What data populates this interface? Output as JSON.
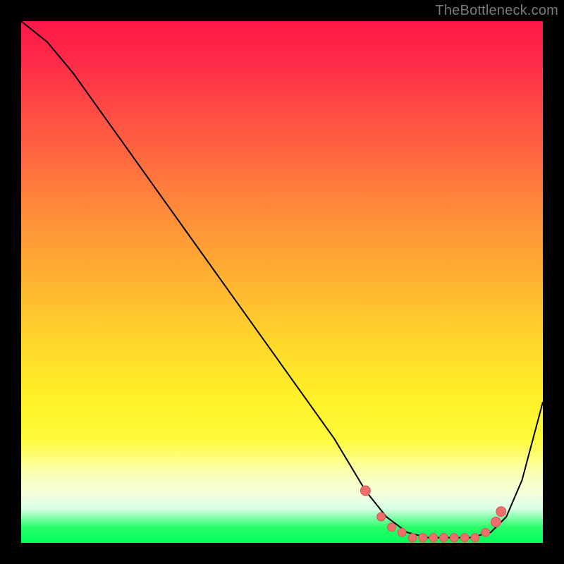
{
  "attribution": "TheBottleneck.com",
  "colors": {
    "curve": "#000000",
    "dot_fill": "#ee6e6c",
    "dot_stroke": "#d05a58"
  },
  "chart_data": {
    "type": "line",
    "title": "",
    "xlabel": "",
    "ylabel": "",
    "xlim": [
      0,
      100
    ],
    "ylim": [
      0,
      100
    ],
    "series": [
      {
        "name": "bottleneck-curve",
        "x": [
          0,
          5,
          10,
          15,
          20,
          25,
          30,
          35,
          40,
          45,
          50,
          55,
          60,
          63,
          66,
          70,
          74,
          78,
          82,
          86,
          90,
          93,
          96,
          100
        ],
        "y": [
          100,
          96,
          90,
          83,
          76,
          69,
          62,
          55,
          48,
          41,
          34,
          27,
          20,
          15,
          10,
          5,
          2,
          1,
          1,
          1,
          2,
          5,
          12,
          27
        ]
      }
    ],
    "dots": {
      "name": "optimal-zone",
      "x": [
        66,
        69,
        71,
        73,
        75,
        77,
        79,
        81,
        83,
        85,
        87,
        89,
        91,
        92
      ],
      "y": [
        10,
        5,
        3,
        2,
        1,
        1,
        1,
        1,
        1,
        1,
        1,
        2,
        4,
        6
      ]
    },
    "gradient_meaning": "vertical color = bottleneck severity (red high, green low)"
  }
}
